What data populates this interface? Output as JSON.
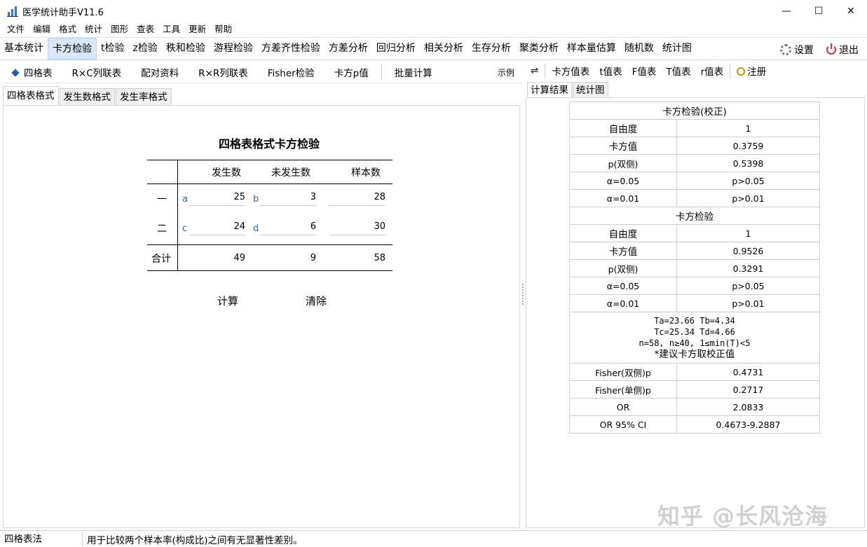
{
  "window": {
    "title": "医学统计助手V11.6",
    "controls": [
      "—",
      "☐",
      "✕"
    ]
  },
  "menu": [
    "文件",
    "编辑",
    "格式",
    "统计",
    "图形",
    "查表",
    "工具",
    "更新",
    "帮助"
  ],
  "modules": {
    "tabs": [
      "基本统计",
      "卡方检验",
      "t检验",
      "z检验",
      "秩和检验",
      "游程检验",
      "方差齐性检验",
      "方差分析",
      "回归分析",
      "相关分析",
      "生存分析",
      "聚类分析",
      "样本量估算",
      "随机数",
      "统计图"
    ],
    "active": "卡方检验",
    "settings_label": "设置",
    "exit_label": "退出"
  },
  "left": {
    "sub_tools": [
      "四格表",
      "R×C列联表",
      "配对资料",
      "R×R列联表",
      "Fisher检验",
      "卡方p值"
    ],
    "batch_label": "批量计算",
    "example_label": "示例",
    "format_tabs": [
      "四格表格式",
      "发生数格式",
      "发生率格式"
    ],
    "table": {
      "title": "四格表格式卡方检验",
      "headers": [
        "发生数",
        "未发生数",
        "样本数"
      ],
      "rows": [
        {
          "label": "一",
          "a_label": "a",
          "a": "25",
          "b_label": "b",
          "b": "3",
          "n": "28"
        },
        {
          "label": "二",
          "c_label": "c",
          "c": "24",
          "d_label": "d",
          "d": "6",
          "n": "30"
        }
      ],
      "total": {
        "label": "合计",
        "c1": "49",
        "c2": "9",
        "n": "58"
      }
    },
    "calc_label": "计算",
    "clear_label": "清除"
  },
  "right": {
    "swap_icon": "⇌",
    "tools": [
      "卡方值表",
      "t值表",
      "F值表",
      "T值表",
      "r值表"
    ],
    "register_label": "注册",
    "tabs": [
      "计算结果",
      "统计图"
    ],
    "results": {
      "corrected_title": "卡方检验(校正)",
      "corrected": [
        {
          "k": "自由度",
          "v": "1"
        },
        {
          "k": "卡方值",
          "v": "0.3759"
        },
        {
          "k": "p(双侧)",
          "v": "0.5398"
        },
        {
          "k": "α=0.05",
          "v": "p>0.05"
        },
        {
          "k": "α=0.01",
          "v": "p>0.01"
        }
      ],
      "plain_title": "卡方检验",
      "plain": [
        {
          "k": "自由度",
          "v": "1"
        },
        {
          "k": "卡方值",
          "v": "0.9526"
        },
        {
          "k": "p(双侧)",
          "v": "0.3291"
        },
        {
          "k": "α=0.05",
          "v": "p>0.05"
        },
        {
          "k": "α=0.01",
          "v": "p>0.01"
        }
      ],
      "note": [
        "Ta=23.66   Tb=4.34",
        "Tc=25.34   Td=4.66",
        "n=58, n≥40, 1≤min(T)<5",
        "*建议卡方取校正值"
      ],
      "extra": [
        {
          "k": "Fisher(双侧)p",
          "v": "0.4731"
        },
        {
          "k": "Fisher(单侧)p",
          "v": "0.2717"
        },
        {
          "k": "OR",
          "v": "2.0833"
        },
        {
          "k": "OR 95% CI",
          "v": "0.4673-9.2887"
        }
      ]
    }
  },
  "watermark": "知乎 @长风沧海",
  "status": {
    "left": "四格表法",
    "right": "用于比较两个样本率(构成比)之间有无显著性差别。"
  }
}
